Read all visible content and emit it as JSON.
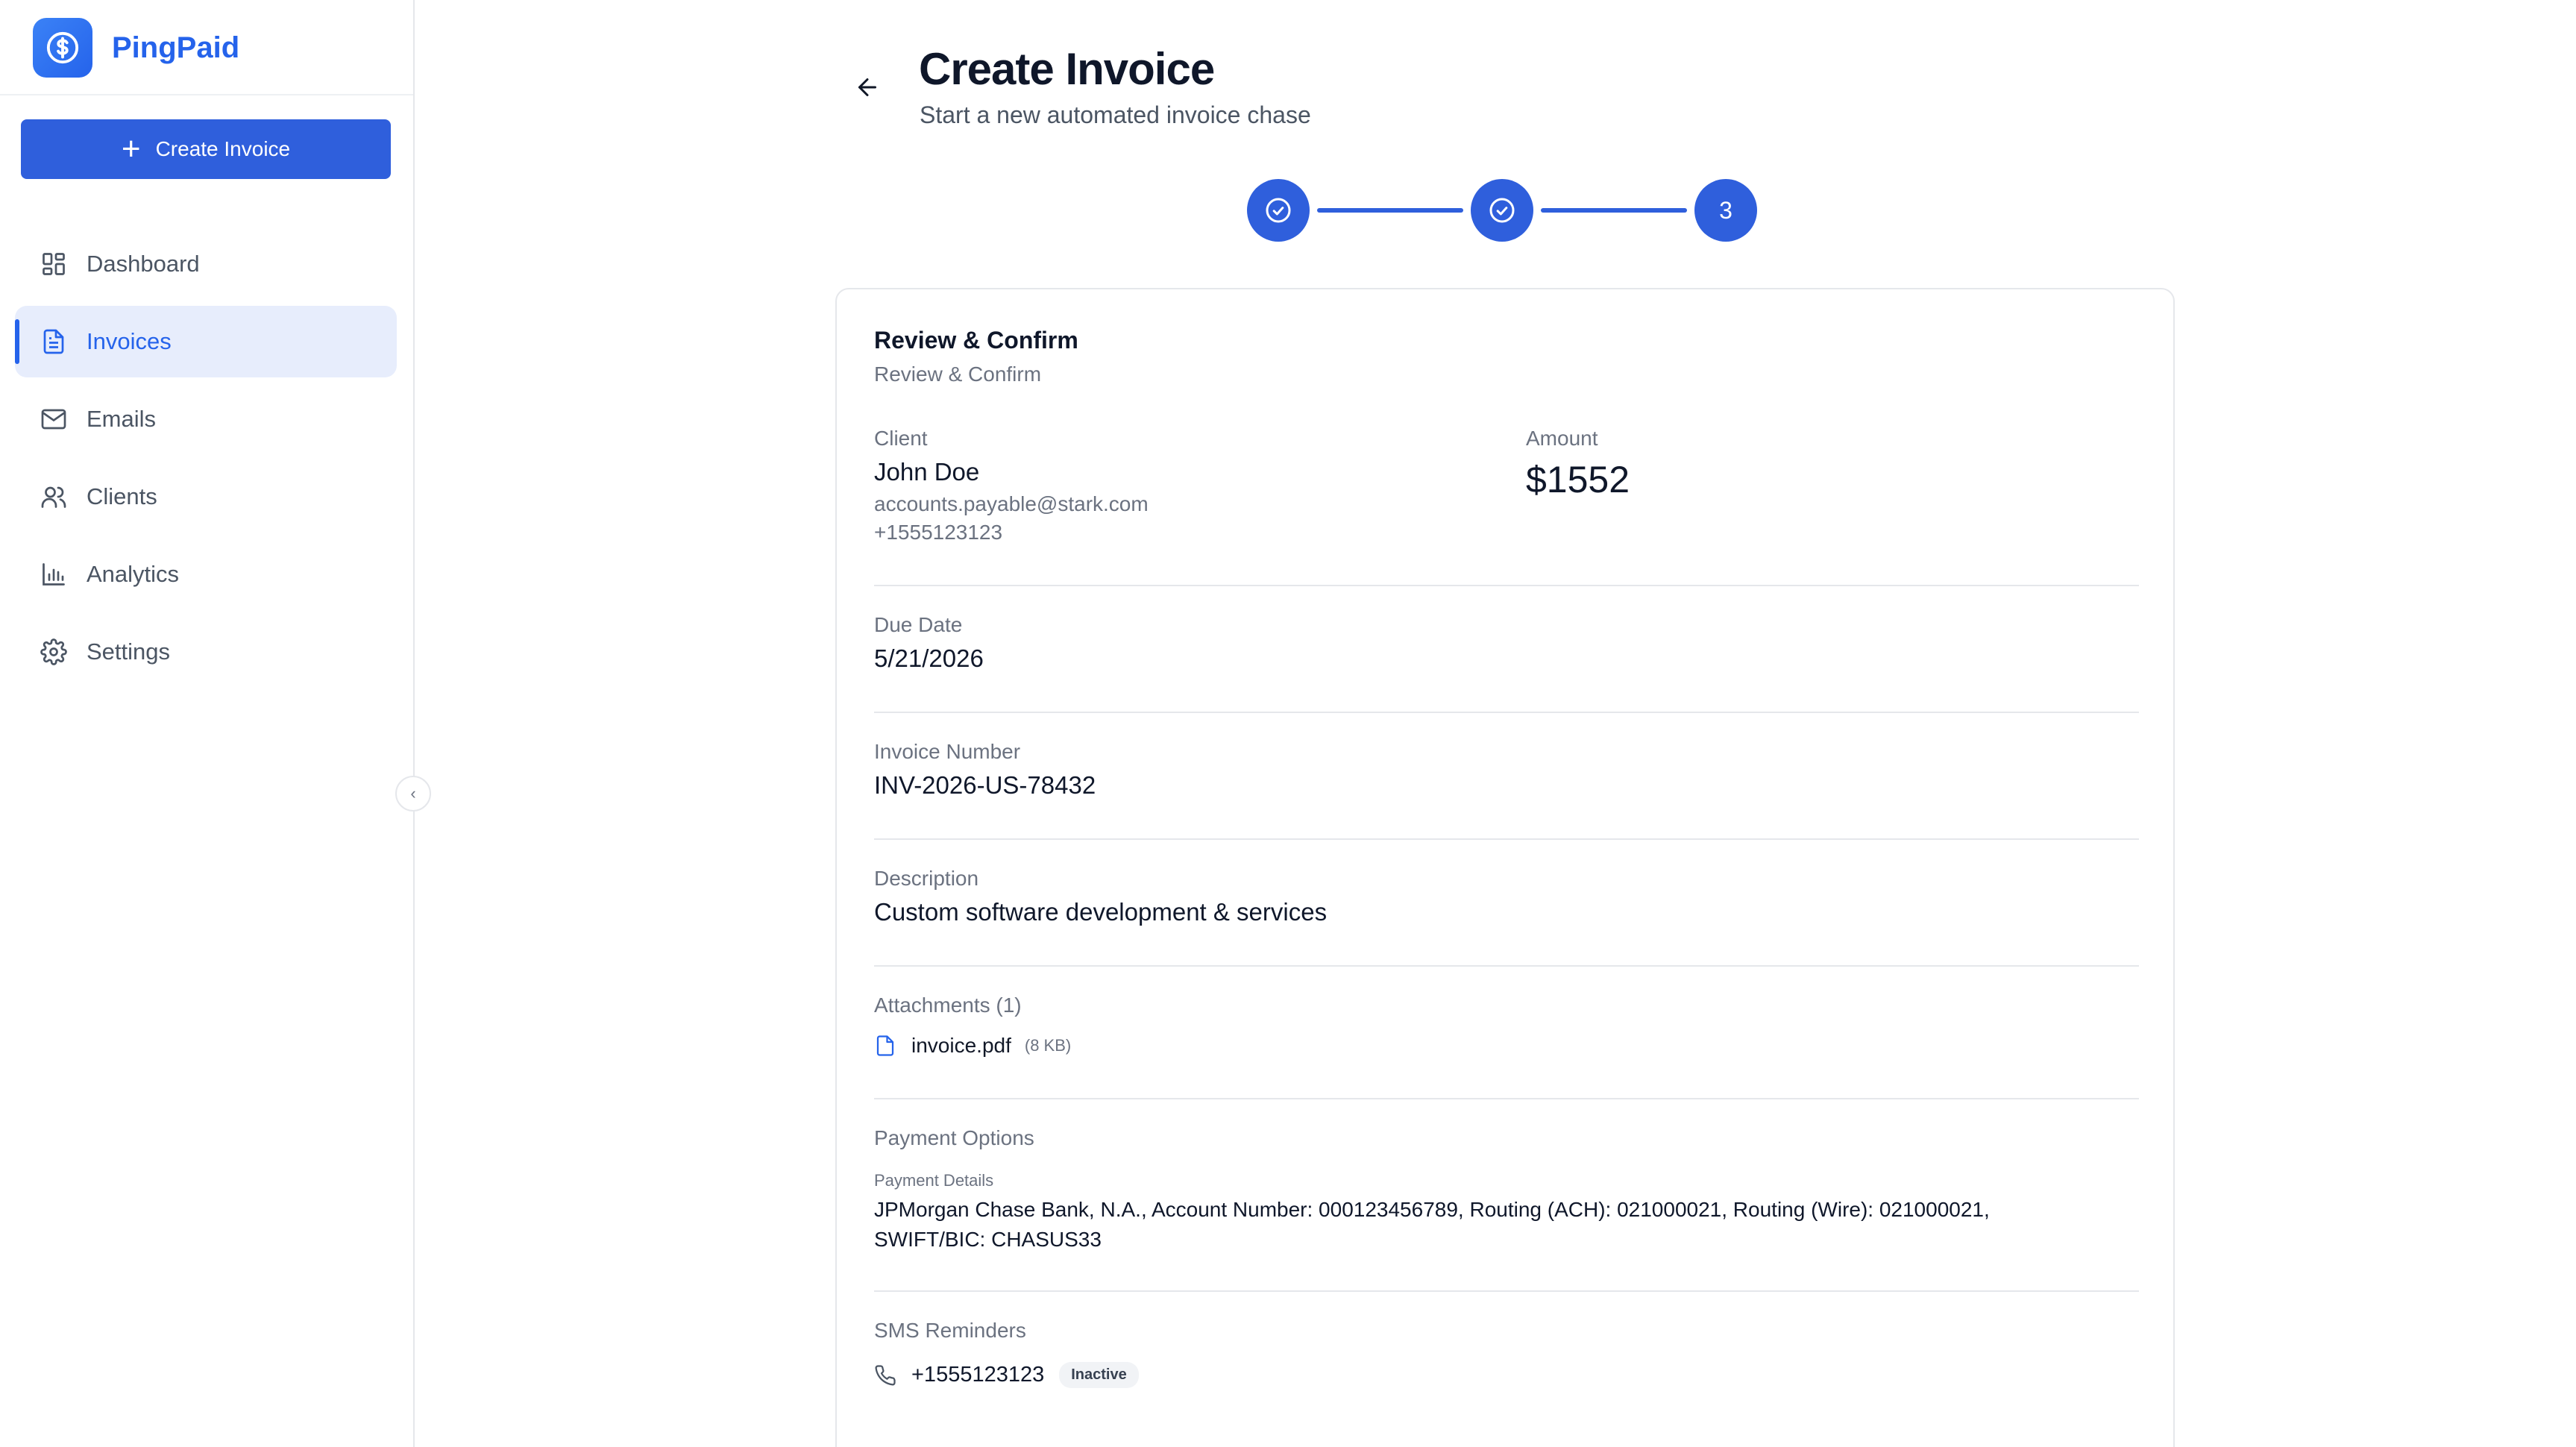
{
  "app": {
    "name": "PingPaid"
  },
  "sidebar": {
    "create_label": "Create Invoice",
    "items": [
      {
        "label": "Dashboard",
        "icon": "dashboard-icon"
      },
      {
        "label": "Invoices",
        "icon": "file-text-icon",
        "active": true
      },
      {
        "label": "Emails",
        "icon": "mail-icon"
      },
      {
        "label": "Clients",
        "icon": "users-icon"
      },
      {
        "label": "Analytics",
        "icon": "bar-chart-icon"
      },
      {
        "label": "Settings",
        "icon": "gear-icon"
      }
    ]
  },
  "header": {
    "title": "Create Invoice",
    "subtitle": "Start a new automated invoice chase"
  },
  "stepper": {
    "steps": [
      {
        "state": "complete",
        "label": ""
      },
      {
        "state": "complete",
        "label": ""
      },
      {
        "state": "current",
        "label": "3"
      }
    ]
  },
  "card": {
    "title": "Review & Confirm",
    "description": "Review & Confirm",
    "client": {
      "label": "Client",
      "name": "John Doe",
      "email": "accounts.payable@stark.com",
      "phone": "+1555123123"
    },
    "amount": {
      "label": "Amount",
      "value": "$1552"
    },
    "due_date": {
      "label": "Due Date",
      "value": "5/21/2026"
    },
    "invoice_number": {
      "label": "Invoice Number",
      "value": "INV-2026-US-78432"
    },
    "description_field": {
      "label": "Description",
      "value": "Custom software development & services"
    },
    "attachments": {
      "label": "Attachments (1)",
      "files": [
        {
          "name": "invoice.pdf",
          "size": "(8 KB)"
        }
      ]
    },
    "payment": {
      "label": "Payment Options",
      "details_label": "Payment Details",
      "details": "JPMorgan Chase Bank, N.A., Account Number: 000123456789, Routing (ACH): 021000021, Routing (Wire): 021000021, SWIFT/BIC: CHASUS33"
    },
    "sms": {
      "label": "SMS Reminders",
      "phone": "+1555123123",
      "status": "Inactive"
    }
  },
  "colors": {
    "accent": "#2f5fdc",
    "brand": "#2563eb",
    "active_bg": "#e7edfc"
  }
}
